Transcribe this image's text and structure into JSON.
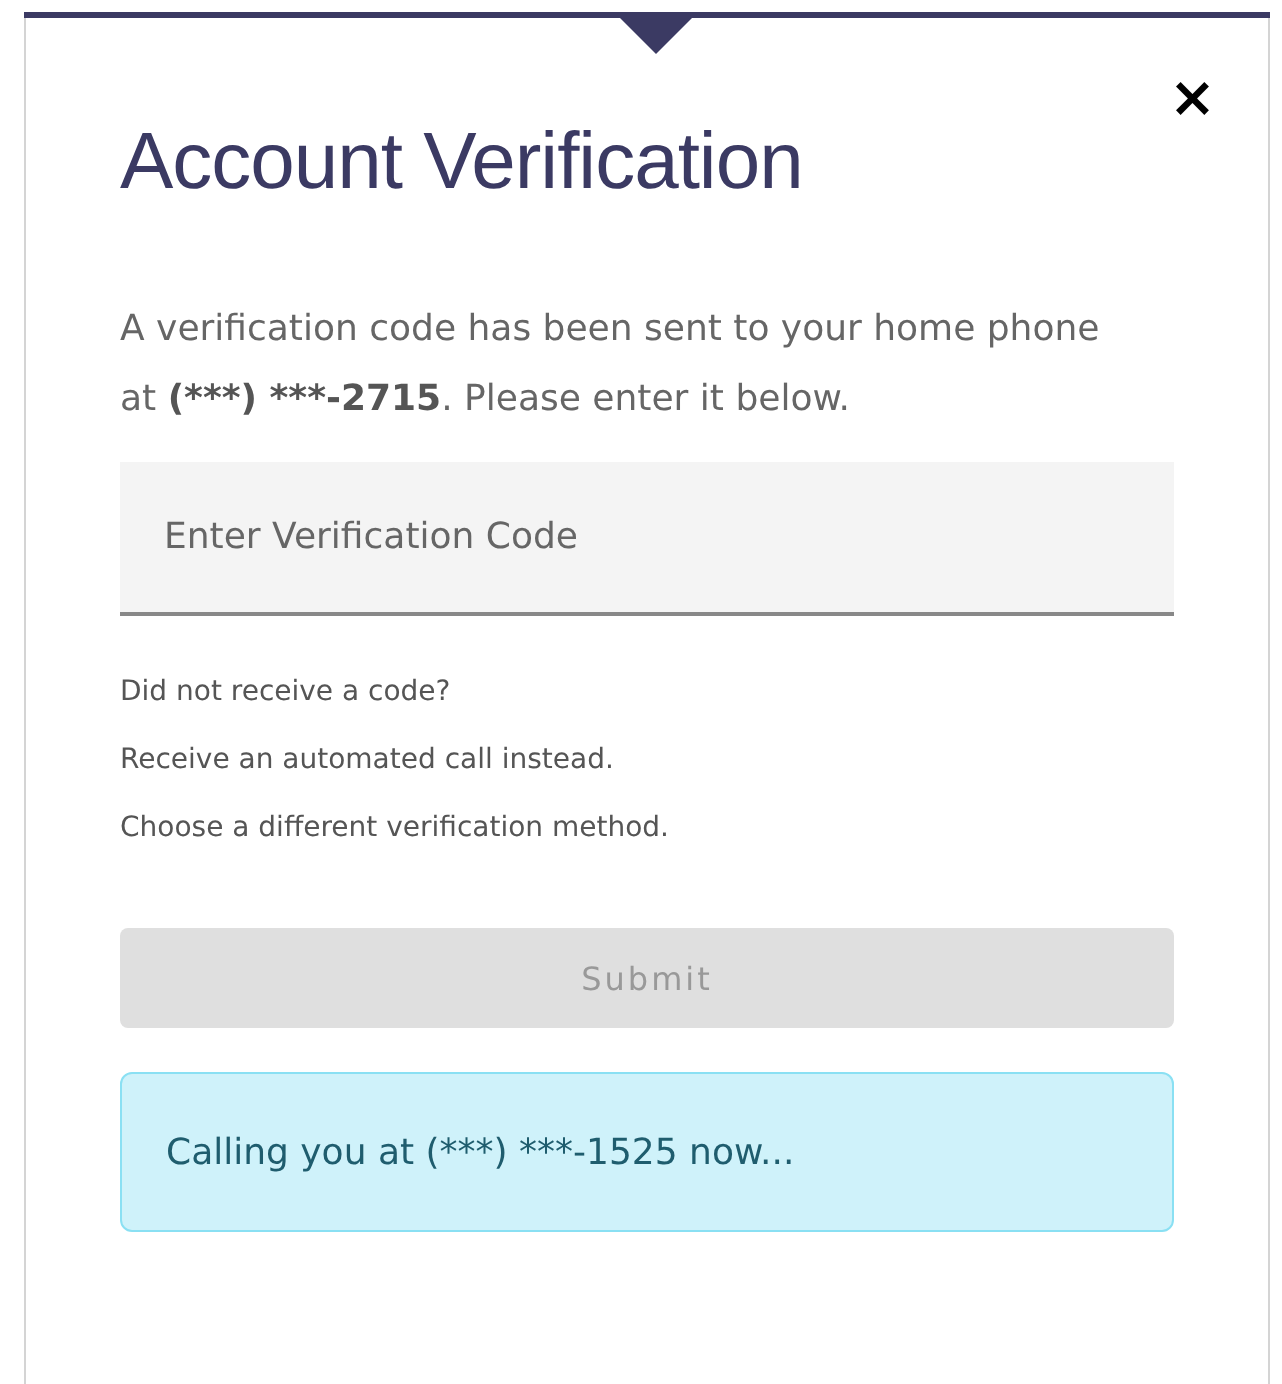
{
  "dialog": {
    "title": "Account Verification",
    "close": "×"
  },
  "message": {
    "before": "A verification code has been sent to your home phone at ",
    "phone": "(***) ***-2715",
    "after": ". Please enter it below."
  },
  "code_field": {
    "placeholder": "Enter Verification Code"
  },
  "help": {
    "question": "Did not receive a code?",
    "links": [
      "Receive an automated call instead.",
      "Choose a different verification method."
    ]
  },
  "submit": {
    "label": "Submit",
    "disabled": true
  },
  "alert": {
    "text": "Calling you at (***) ***-1525 now..."
  }
}
